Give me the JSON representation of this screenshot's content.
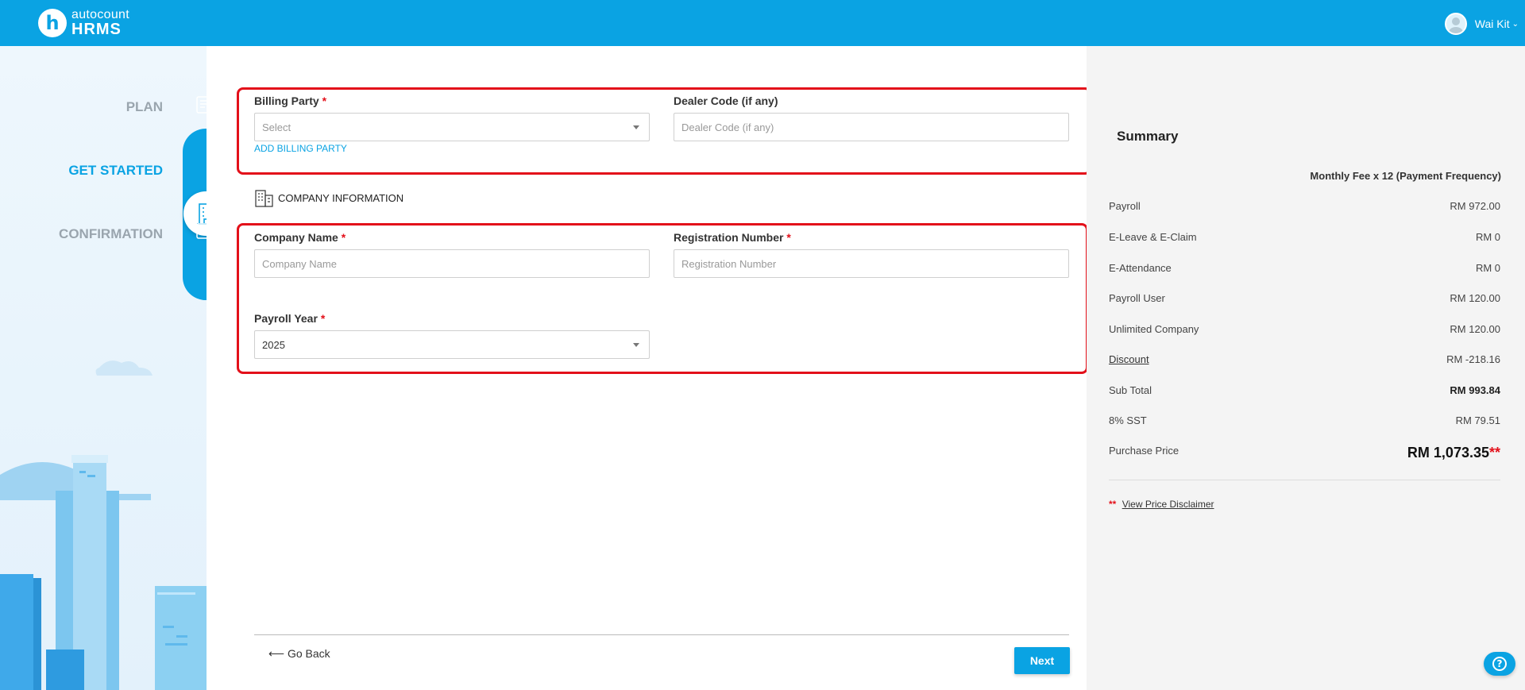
{
  "header": {
    "logo_mark": "h",
    "logo_line1": "autocount",
    "logo_line2": "HRMS",
    "user_name": "Wai Kit",
    "user_chevron": "⌄"
  },
  "steps": [
    {
      "label": "PLAN",
      "state": "inactive",
      "icon": "plan-icon"
    },
    {
      "label": "GET STARTED",
      "state": "active",
      "icon": "building-icon"
    },
    {
      "label": "CONFIRMATION",
      "state": "inactive",
      "icon": "confirmation-icon"
    }
  ],
  "billing": {
    "billing_party_label": "Billing Party",
    "billing_party_placeholder": "Select",
    "add_billing_party": "ADD BILLING PARTY",
    "dealer_code_label": "Dealer Code (if any)",
    "dealer_code_placeholder": "Dealer Code (if any)"
  },
  "company": {
    "section_title": "COMPANY INFORMATION",
    "company_name_label": "Company Name",
    "company_name_placeholder": "Company Name",
    "registration_label": "Registration Number",
    "registration_placeholder": "Registration Number",
    "payroll_year_label": "Payroll Year",
    "payroll_year_value": "2025"
  },
  "required_mark": "*",
  "footer": {
    "go_back": "⟵ Go Back",
    "next": "Next"
  },
  "summary": {
    "title": "Summary",
    "frequency": "Monthly Fee x 12 (Payment Frequency)",
    "rows": [
      {
        "label": "Payroll",
        "value": "RM 972.00"
      },
      {
        "label": "E-Leave & E-Claim",
        "value": "RM 0"
      },
      {
        "label": "E-Attendance",
        "value": "RM 0"
      },
      {
        "label": "Payroll User",
        "value": "RM 120.00"
      },
      {
        "label": "Unlimited Company",
        "value": "RM 120.00"
      },
      {
        "label": "Discount",
        "value": "RM -218.16"
      },
      {
        "label": "Sub Total",
        "value": "RM 993.84"
      },
      {
        "label": "8% SST",
        "value": "RM 79.51"
      }
    ],
    "purchase_label": "Purchase Price",
    "purchase_value": "RM 1,073.35",
    "purchase_stars": "**",
    "disclaimer_stars": "**",
    "disclaimer_link": "View Price Disclaimer",
    "help_glyph": "?"
  },
  "colors": {
    "brand": "#0aa3e3",
    "highlight": "#e3101a"
  }
}
